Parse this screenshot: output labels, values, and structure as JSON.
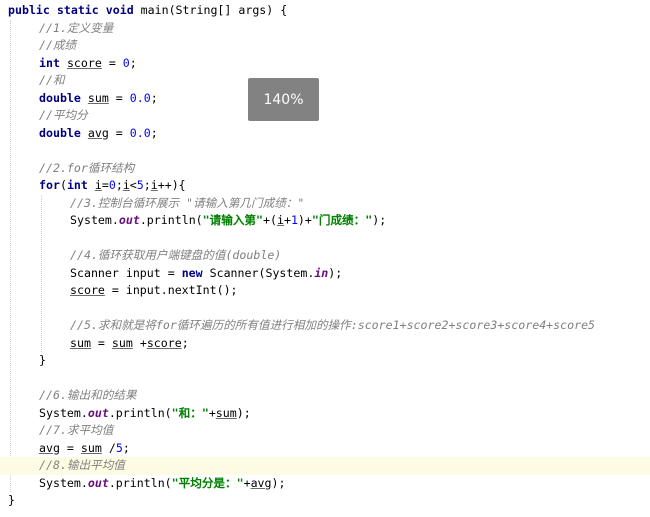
{
  "zoom": {
    "label": "140%"
  },
  "code": {
    "lines": [
      {
        "indent": 0,
        "tokens": [
          [
            "kw",
            "public"
          ],
          [
            "p",
            " "
          ],
          [
            "kw",
            "static"
          ],
          [
            "p",
            " "
          ],
          [
            "kw",
            "void"
          ],
          [
            "p",
            " main(String[] args) {"
          ]
        ]
      },
      {
        "indent": 1,
        "tokens": [
          [
            "cm",
            "//1.定义变量"
          ]
        ]
      },
      {
        "indent": 1,
        "tokens": [
          [
            "cm",
            "//成绩"
          ]
        ]
      },
      {
        "indent": 1,
        "tokens": [
          [
            "kw",
            "int"
          ],
          [
            "p",
            " "
          ],
          [
            "var",
            "score"
          ],
          [
            "p",
            " = "
          ],
          [
            "nm",
            "0"
          ],
          [
            "p",
            ";"
          ]
        ]
      },
      {
        "indent": 1,
        "tokens": [
          [
            "cm",
            "//和"
          ]
        ]
      },
      {
        "indent": 1,
        "tokens": [
          [
            "kw",
            "double"
          ],
          [
            "p",
            " "
          ],
          [
            "var",
            "sum"
          ],
          [
            "p",
            " = "
          ],
          [
            "nm",
            "0.0"
          ],
          [
            "p",
            ";"
          ]
        ]
      },
      {
        "indent": 1,
        "tokens": [
          [
            "cm",
            "//平均分"
          ]
        ]
      },
      {
        "indent": 1,
        "tokens": [
          [
            "kw",
            "double"
          ],
          [
            "p",
            " "
          ],
          [
            "var",
            "avg"
          ],
          [
            "p",
            " = "
          ],
          [
            "nm",
            "0.0"
          ],
          [
            "p",
            ";"
          ]
        ]
      },
      {
        "indent": 0,
        "tokens": []
      },
      {
        "indent": 1,
        "tokens": [
          [
            "cm",
            "//2.for循环结构"
          ]
        ]
      },
      {
        "indent": 1,
        "tokens": [
          [
            "kw",
            "for"
          ],
          [
            "p",
            "("
          ],
          [
            "kw",
            "int"
          ],
          [
            "p",
            " "
          ],
          [
            "var",
            "i"
          ],
          [
            "p",
            "="
          ],
          [
            "nm",
            "0"
          ],
          [
            "p",
            ";"
          ],
          [
            "var",
            "i"
          ],
          [
            "p",
            "<"
          ],
          [
            "nm",
            "5"
          ],
          [
            "p",
            ";"
          ],
          [
            "var",
            "i"
          ],
          [
            "p",
            "++){"
          ]
        ]
      },
      {
        "indent": 2,
        "tokens": [
          [
            "cm",
            "//3.控制台循环展示 \"请输入第几门成绩：\""
          ]
        ]
      },
      {
        "indent": 2,
        "tokens": [
          [
            "p",
            "System."
          ],
          [
            "fld",
            "out"
          ],
          [
            "p",
            ".println("
          ],
          [
            "st",
            "\"请输入第\""
          ],
          [
            "p",
            "+("
          ],
          [
            "var",
            "i"
          ],
          [
            "p",
            "+"
          ],
          [
            "nm",
            "1"
          ],
          [
            "p",
            ")+"
          ],
          [
            "st",
            "\"门成绩：\""
          ],
          [
            "p",
            ");"
          ]
        ]
      },
      {
        "indent": 0,
        "tokens": []
      },
      {
        "indent": 2,
        "tokens": [
          [
            "cm",
            "//4.循环获取用户端键盘的值(double)"
          ]
        ]
      },
      {
        "indent": 2,
        "tokens": [
          [
            "p",
            "Scanner input = "
          ],
          [
            "kw",
            "new"
          ],
          [
            "p",
            " Scanner(System."
          ],
          [
            "fld",
            "in"
          ],
          [
            "p",
            ");"
          ]
        ]
      },
      {
        "indent": 2,
        "tokens": [
          [
            "var",
            "score"
          ],
          [
            "p",
            " = input.nextInt();"
          ]
        ]
      },
      {
        "indent": 0,
        "tokens": []
      },
      {
        "indent": 2,
        "tokens": [
          [
            "cm",
            "//5.求和就是将for循环遍历的所有值进行相加的操作:score1+score2+score3+score4+score5"
          ]
        ]
      },
      {
        "indent": 2,
        "tokens": [
          [
            "var",
            "sum"
          ],
          [
            "p",
            " = "
          ],
          [
            "var",
            "sum"
          ],
          [
            "p",
            " +"
          ],
          [
            "var",
            "score"
          ],
          [
            "p",
            ";"
          ]
        ]
      },
      {
        "indent": 1,
        "tokens": [
          [
            "p",
            "}"
          ]
        ]
      },
      {
        "indent": 0,
        "tokens": []
      },
      {
        "indent": 1,
        "tokens": [
          [
            "cm",
            "//6.输出和的结果"
          ]
        ]
      },
      {
        "indent": 1,
        "tokens": [
          [
            "p",
            "System."
          ],
          [
            "fld",
            "out"
          ],
          [
            "p",
            ".println("
          ],
          [
            "st",
            "\"和：\""
          ],
          [
            "p",
            "+"
          ],
          [
            "var",
            "sum"
          ],
          [
            "p",
            ");"
          ]
        ]
      },
      {
        "indent": 1,
        "tokens": [
          [
            "cm",
            "//7.求平均值"
          ]
        ]
      },
      {
        "indent": 1,
        "tokens": [
          [
            "var",
            "avg"
          ],
          [
            "p",
            " = "
          ],
          [
            "var",
            "sum"
          ],
          [
            "p",
            " /"
          ],
          [
            "nm",
            "5"
          ],
          [
            "p",
            ";"
          ]
        ]
      },
      {
        "indent": 1,
        "highlight": true,
        "tokens": [
          [
            "cm",
            "//8.输出平均值"
          ]
        ]
      },
      {
        "indent": 1,
        "tokens": [
          [
            "p",
            "System."
          ],
          [
            "fld",
            "out"
          ],
          [
            "p",
            ".println("
          ],
          [
            "st",
            "\"平均分是：\""
          ],
          [
            "p",
            "+"
          ],
          [
            "var",
            "avg"
          ],
          [
            "p",
            ");"
          ]
        ]
      },
      {
        "indent": 0,
        "tokens": [
          [
            "p",
            "}"
          ]
        ]
      }
    ]
  }
}
